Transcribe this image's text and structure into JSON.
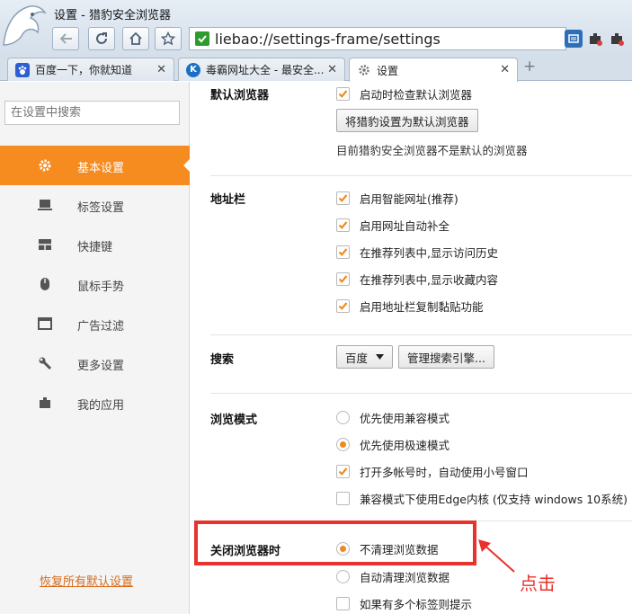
{
  "window": {
    "title": "设置 - 猎豹安全浏览器"
  },
  "address": {
    "url": "liebao://settings-frame/settings"
  },
  "tabs": [
    {
      "label": "百度一下，你就知道",
      "icon": "baidu-paw-icon"
    },
    {
      "label": "毒霸网址大全 - 最安全...",
      "icon": "k-logo-icon"
    },
    {
      "label": "设置",
      "icon": "gear-icon"
    }
  ],
  "sidebar": {
    "search_placeholder": "在设置中搜索",
    "items": [
      {
        "label": "基本设置",
        "icon": "gear-icon"
      },
      {
        "label": "标签设置",
        "icon": "laptop-icon"
      },
      {
        "label": "快捷键",
        "icon": "keyboard-icon"
      },
      {
        "label": "鼠标手势",
        "icon": "mouse-icon"
      },
      {
        "label": "广告过滤",
        "icon": "window-icon"
      },
      {
        "label": "更多设置",
        "icon": "wrench-icon"
      },
      {
        "label": "我的应用",
        "icon": "puzzle-icon"
      }
    ],
    "restore_link": "恢复所有默认设置"
  },
  "sections": {
    "default_browser": {
      "title": "默认浏览器",
      "check_on_start": "启动时检查默认浏览器",
      "set_default_button": "将猎豹设置为默认浏览器",
      "status": "目前猎豹安全浏览器不是默认的浏览器"
    },
    "address_bar": {
      "title": "地址栏",
      "options": [
        "启用智能网址(推荐)",
        "启用网址自动补全",
        "在推荐列表中,显示访问历史",
        "在推荐列表中,显示收藏内容",
        "启用地址栏复制黏贴功能"
      ]
    },
    "search": {
      "title": "搜索",
      "engine": "百度",
      "manage_button": "管理搜索引擎..."
    },
    "browse_mode": {
      "title": "浏览模式",
      "compat_mode": "优先使用兼容模式",
      "speed_mode": "优先使用极速模式",
      "multi_account": "打开多帐号时，自动使用小号窗口",
      "edge_kernel": "兼容模式下使用Edge内核 (仅支持 windows 10系统)"
    },
    "on_close": {
      "title": "关闭浏览器时",
      "keep_data": "不清理浏览数据",
      "auto_clean": "自动清理浏览数据",
      "multi_tab_prompt": "如果有多个标签则提示"
    }
  },
  "annotation": {
    "text": "点击"
  },
  "colors": {
    "accent": "#f68b1f",
    "annotation": "#e8322d",
    "check": "#f08a1c"
  }
}
